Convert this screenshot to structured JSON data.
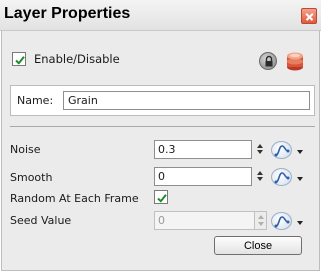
{
  "window": {
    "title": "Layer Properties",
    "close_icon": "close-x-icon",
    "accent": "#e0583c"
  },
  "enable": {
    "label": "Enable/Disable",
    "checked": true,
    "lock_icon": "lock-icon",
    "database_icon": "database-icon"
  },
  "name": {
    "label": "Name:",
    "value": "Grain"
  },
  "params": {
    "noise": {
      "label": "Noise",
      "value": "0.3"
    },
    "smooth": {
      "label": "Smooth",
      "value": "0"
    },
    "random": {
      "label": "Random At Each Frame",
      "checked": true
    },
    "seed": {
      "label": "Seed Value",
      "value": "0",
      "disabled": true
    }
  },
  "buttons": {
    "close_label": "Close"
  }
}
